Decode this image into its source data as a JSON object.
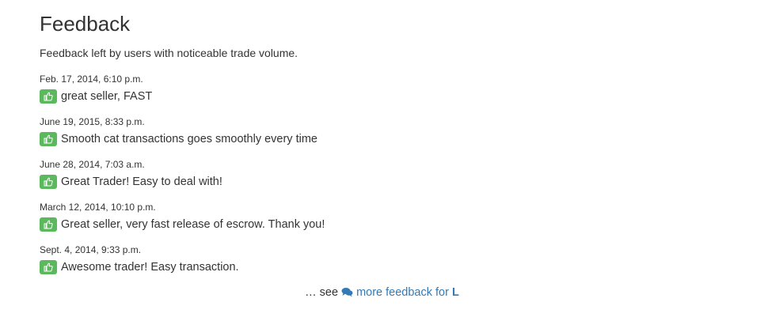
{
  "page": {
    "title": "Feedback",
    "subtitle": "Feedback left by users with noticeable trade volume."
  },
  "colors": {
    "positive_badge": "#5cb85c",
    "link": "#337ab7",
    "text": "#333333"
  },
  "feedback": [
    {
      "date": "Feb. 17, 2014, 6:10 p.m.",
      "rating": "positive",
      "icon": "thumbs-up-icon",
      "text": "great seller, FAST"
    },
    {
      "date": "June 19, 2015, 8:33 p.m.",
      "rating": "positive",
      "icon": "thumbs-up-icon",
      "text": "Smooth cat transactions goes smoothly every time"
    },
    {
      "date": "June 28, 2014, 7:03 a.m.",
      "rating": "positive",
      "icon": "thumbs-up-icon",
      "text": "Great Trader! Easy to deal with!"
    },
    {
      "date": "March 12, 2014, 10:10 p.m.",
      "rating": "positive",
      "icon": "thumbs-up-icon",
      "text": "Great seller, very fast release of escrow. Thank you!"
    },
    {
      "date": "Sept. 4, 2014, 9:33 p.m.",
      "rating": "positive",
      "icon": "thumbs-up-icon",
      "text": "Awesome trader! Easy transaction."
    }
  ],
  "more_feedback": {
    "prefix": "… see ",
    "icon": "comments-icon",
    "link_label": "more feedback for",
    "username": "L"
  }
}
